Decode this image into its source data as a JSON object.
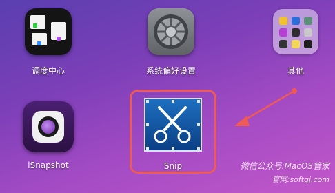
{
  "launchpad": {
    "apps": [
      {
        "label": "调度中心",
        "icon": "mission-control-icon"
      },
      {
        "label": "系统偏好设置",
        "icon": "system-preferences-icon"
      },
      {
        "label": "其他",
        "icon": "folder-icon"
      },
      {
        "label": "iSnapshot",
        "icon": "isnapshot-icon"
      },
      {
        "label": "Snip",
        "icon": "snip-icon"
      }
    ]
  },
  "watermark": {
    "line1": "微信公众号:MacOS管家",
    "line2": "官网:softgj.com"
  },
  "colors": {
    "highlight": "#ee5a55",
    "arrow": "#ee5a55"
  }
}
